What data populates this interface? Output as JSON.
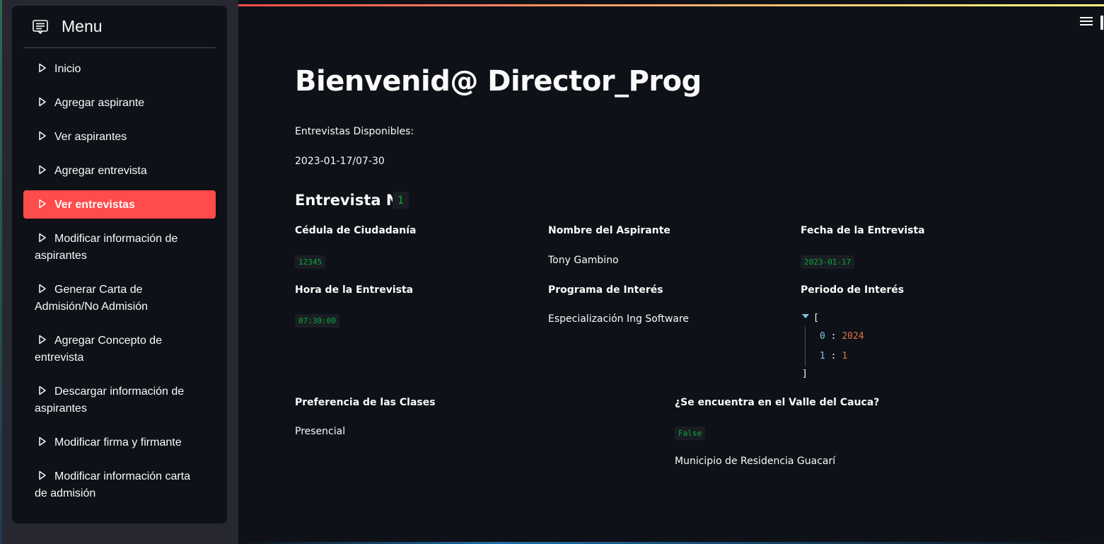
{
  "sidebar": {
    "title": "Menu",
    "items": [
      {
        "label": "Inicio"
      },
      {
        "label": "Agregar aspirante"
      },
      {
        "label": "Ver aspirantes"
      },
      {
        "label": "Agregar entrevista"
      },
      {
        "label": "Ver entrevistas",
        "active": true
      },
      {
        "label": "Modificar información de aspirantes"
      },
      {
        "label": "Generar Carta de Admisión/No Admisión"
      },
      {
        "label": "Agregar Concepto de entrevista"
      },
      {
        "label": "Descargar información de aspirantes"
      },
      {
        "label": "Modificar firma y firmante"
      },
      {
        "label": "Modificar información carta de admisión"
      }
    ]
  },
  "main": {
    "title": "Bienvenid@ Director_Prog",
    "available_label": "Entrevistas Disponibles:",
    "available_value": "2023-01-17/07-30",
    "interview_heading": "Entrevista N°",
    "interview_number": "1",
    "fields": {
      "cedula_label": "Cédula de Ciudadanía",
      "cedula_value": "12345",
      "nombre_label": "Nombre del Aspirante",
      "nombre_value": "Tony Gambino",
      "fecha_label": "Fecha de la Entrevista",
      "fecha_value": "2023-01-17",
      "hora_label": "Hora de la Entrevista",
      "hora_value": "07:30:00",
      "programa_label": "Programa de Interés",
      "programa_value": "Especialización Ing Software",
      "periodo_label": "Periodo de Interés",
      "periodo_values": [
        "2024",
        "1"
      ],
      "preferencia_label": "Preferencia de las Clases",
      "preferencia_value": "Presencial",
      "valle_label": "¿Se encuentra en el Valle del Cauca?",
      "valle_value": "False",
      "municipio_text": "Municipio de Residencia Guacarí"
    }
  },
  "colors": {
    "background": "#0e1117",
    "sidebar": "#262730",
    "accent": "#ff4b4b",
    "code_green": "#09ab3b",
    "json_key": "#7fc6e4",
    "json_number": "#e0734d"
  },
  "icons": {
    "menu": "menu-list-icon",
    "nav_caret": "caret-right-icon",
    "hamburger": "hamburger-icon"
  }
}
